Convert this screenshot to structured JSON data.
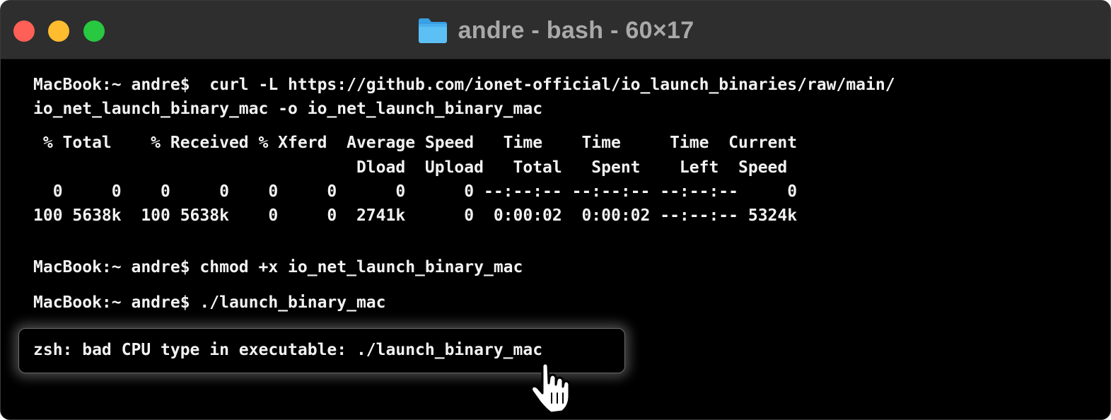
{
  "window": {
    "title": "andre - bash - 60×17",
    "title_icon": "folder-icon",
    "traffic_lights": {
      "close_color": "#fe5f57",
      "minimize_color": "#febc2e",
      "maximize_color": "#28c840"
    }
  },
  "terminal": {
    "lines": [
      "MacBook:~ andre$  curl -L https://github.com/ionet-official/io_launch_binaries/raw/main/",
      "io_net_launch_binary_mac -o io_net_launch_binary_mac",
      " % Total    % Received % Xferd  Average Speed   Time    Time     Time  Current",
      "                                 Dload  Upload   Total   Spent    Left  Speed",
      "  0     0    0     0    0     0      0      0 --:--:-- --:--:-- --:--:--     0",
      "100 5638k  100 5638k    0     0  2741k      0  0:00:02  0:00:02 --:--:-- 5324k",
      "MacBook:~ andre$ chmod +x io_net_launch_binary_mac",
      "MacBook:~ andre$ ./launch_binary_mac"
    ],
    "error_message": "zsh: bad CPU type in executable: ./launch_binary_mac",
    "cursor_icon": "hand-pointer-icon"
  }
}
